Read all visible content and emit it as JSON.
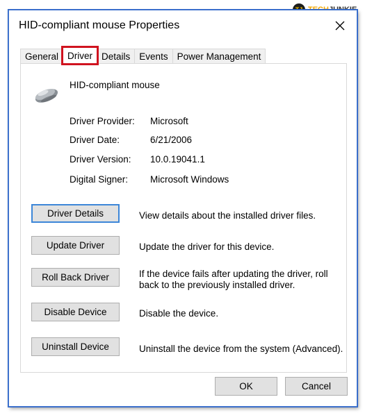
{
  "watermark": {
    "badge": "TJ",
    "text_a": "TECH",
    "text_b": "JUNKIE"
  },
  "window": {
    "title": "HID-compliant mouse Properties"
  },
  "tabs": [
    {
      "label": "General",
      "active": false
    },
    {
      "label": "Driver",
      "active": true
    },
    {
      "label": "Details",
      "active": false
    },
    {
      "label": "Events",
      "active": false
    },
    {
      "label": "Power Management",
      "active": false
    }
  ],
  "device": {
    "name": "HID-compliant mouse",
    "icon": "mouse-icon"
  },
  "info": [
    {
      "label": "Driver Provider:",
      "value": "Microsoft"
    },
    {
      "label": "Driver Date:",
      "value": "6/21/2006"
    },
    {
      "label": "Driver Version:",
      "value": "10.0.19041.1"
    },
    {
      "label": "Digital Signer:",
      "value": "Microsoft Windows"
    }
  ],
  "actions": [
    {
      "label": "Driver Details",
      "description": "View details about the installed driver files."
    },
    {
      "label": "Update Driver",
      "description": "Update the driver for this device."
    },
    {
      "label": "Roll Back Driver",
      "description_line1": "If the device fails after updating the driver, roll",
      "description_line2": "back to the previously installed driver."
    },
    {
      "label": "Disable Device",
      "description": "Disable the device."
    },
    {
      "label": "Uninstall Device",
      "description": "Uninstall the device from the system (Advanced)."
    }
  ],
  "footer": {
    "ok_label": "OK",
    "cancel_label": "Cancel"
  },
  "colors": {
    "highlight": "#d0131f",
    "focus": "#3c86d8",
    "frame": "#2c64c8"
  }
}
